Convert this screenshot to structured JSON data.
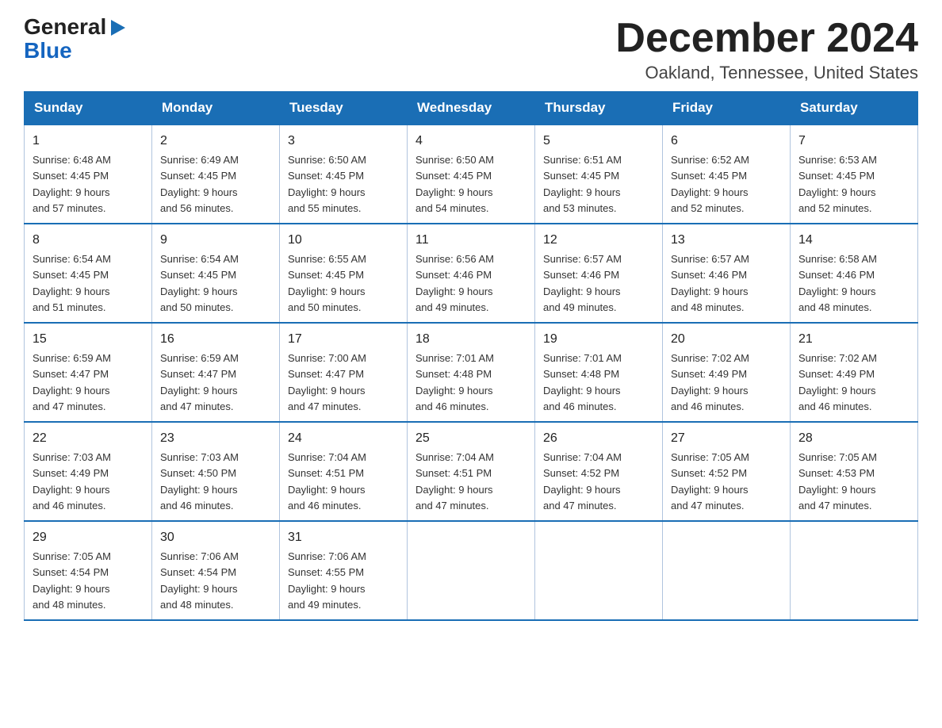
{
  "header": {
    "logo_general": "General",
    "logo_blue": "Blue",
    "month_title": "December 2024",
    "location": "Oakland, Tennessee, United States"
  },
  "days_of_week": [
    "Sunday",
    "Monday",
    "Tuesday",
    "Wednesday",
    "Thursday",
    "Friday",
    "Saturday"
  ],
  "weeks": [
    [
      {
        "day": "1",
        "sunrise": "6:48 AM",
        "sunset": "4:45 PM",
        "daylight": "9 hours and 57 minutes."
      },
      {
        "day": "2",
        "sunrise": "6:49 AM",
        "sunset": "4:45 PM",
        "daylight": "9 hours and 56 minutes."
      },
      {
        "day": "3",
        "sunrise": "6:50 AM",
        "sunset": "4:45 PM",
        "daylight": "9 hours and 55 minutes."
      },
      {
        "day": "4",
        "sunrise": "6:50 AM",
        "sunset": "4:45 PM",
        "daylight": "9 hours and 54 minutes."
      },
      {
        "day": "5",
        "sunrise": "6:51 AM",
        "sunset": "4:45 PM",
        "daylight": "9 hours and 53 minutes."
      },
      {
        "day": "6",
        "sunrise": "6:52 AM",
        "sunset": "4:45 PM",
        "daylight": "9 hours and 52 minutes."
      },
      {
        "day": "7",
        "sunrise": "6:53 AM",
        "sunset": "4:45 PM",
        "daylight": "9 hours and 52 minutes."
      }
    ],
    [
      {
        "day": "8",
        "sunrise": "6:54 AM",
        "sunset": "4:45 PM",
        "daylight": "9 hours and 51 minutes."
      },
      {
        "day": "9",
        "sunrise": "6:54 AM",
        "sunset": "4:45 PM",
        "daylight": "9 hours and 50 minutes."
      },
      {
        "day": "10",
        "sunrise": "6:55 AM",
        "sunset": "4:45 PM",
        "daylight": "9 hours and 50 minutes."
      },
      {
        "day": "11",
        "sunrise": "6:56 AM",
        "sunset": "4:46 PM",
        "daylight": "9 hours and 49 minutes."
      },
      {
        "day": "12",
        "sunrise": "6:57 AM",
        "sunset": "4:46 PM",
        "daylight": "9 hours and 49 minutes."
      },
      {
        "day": "13",
        "sunrise": "6:57 AM",
        "sunset": "4:46 PM",
        "daylight": "9 hours and 48 minutes."
      },
      {
        "day": "14",
        "sunrise": "6:58 AM",
        "sunset": "4:46 PM",
        "daylight": "9 hours and 48 minutes."
      }
    ],
    [
      {
        "day": "15",
        "sunrise": "6:59 AM",
        "sunset": "4:47 PM",
        "daylight": "9 hours and 47 minutes."
      },
      {
        "day": "16",
        "sunrise": "6:59 AM",
        "sunset": "4:47 PM",
        "daylight": "9 hours and 47 minutes."
      },
      {
        "day": "17",
        "sunrise": "7:00 AM",
        "sunset": "4:47 PM",
        "daylight": "9 hours and 47 minutes."
      },
      {
        "day": "18",
        "sunrise": "7:01 AM",
        "sunset": "4:48 PM",
        "daylight": "9 hours and 46 minutes."
      },
      {
        "day": "19",
        "sunrise": "7:01 AM",
        "sunset": "4:48 PM",
        "daylight": "9 hours and 46 minutes."
      },
      {
        "day": "20",
        "sunrise": "7:02 AM",
        "sunset": "4:49 PM",
        "daylight": "9 hours and 46 minutes."
      },
      {
        "day": "21",
        "sunrise": "7:02 AM",
        "sunset": "4:49 PM",
        "daylight": "9 hours and 46 minutes."
      }
    ],
    [
      {
        "day": "22",
        "sunrise": "7:03 AM",
        "sunset": "4:49 PM",
        "daylight": "9 hours and 46 minutes."
      },
      {
        "day": "23",
        "sunrise": "7:03 AM",
        "sunset": "4:50 PM",
        "daylight": "9 hours and 46 minutes."
      },
      {
        "day": "24",
        "sunrise": "7:04 AM",
        "sunset": "4:51 PM",
        "daylight": "9 hours and 46 minutes."
      },
      {
        "day": "25",
        "sunrise": "7:04 AM",
        "sunset": "4:51 PM",
        "daylight": "9 hours and 47 minutes."
      },
      {
        "day": "26",
        "sunrise": "7:04 AM",
        "sunset": "4:52 PM",
        "daylight": "9 hours and 47 minutes."
      },
      {
        "day": "27",
        "sunrise": "7:05 AM",
        "sunset": "4:52 PM",
        "daylight": "9 hours and 47 minutes."
      },
      {
        "day": "28",
        "sunrise": "7:05 AM",
        "sunset": "4:53 PM",
        "daylight": "9 hours and 47 minutes."
      }
    ],
    [
      {
        "day": "29",
        "sunrise": "7:05 AM",
        "sunset": "4:54 PM",
        "daylight": "9 hours and 48 minutes."
      },
      {
        "day": "30",
        "sunrise": "7:06 AM",
        "sunset": "4:54 PM",
        "daylight": "9 hours and 48 minutes."
      },
      {
        "day": "31",
        "sunrise": "7:06 AM",
        "sunset": "4:55 PM",
        "daylight": "9 hours and 49 minutes."
      },
      null,
      null,
      null,
      null
    ]
  ],
  "labels": {
    "sunrise": "Sunrise:",
    "sunset": "Sunset:",
    "daylight": "Daylight:"
  }
}
